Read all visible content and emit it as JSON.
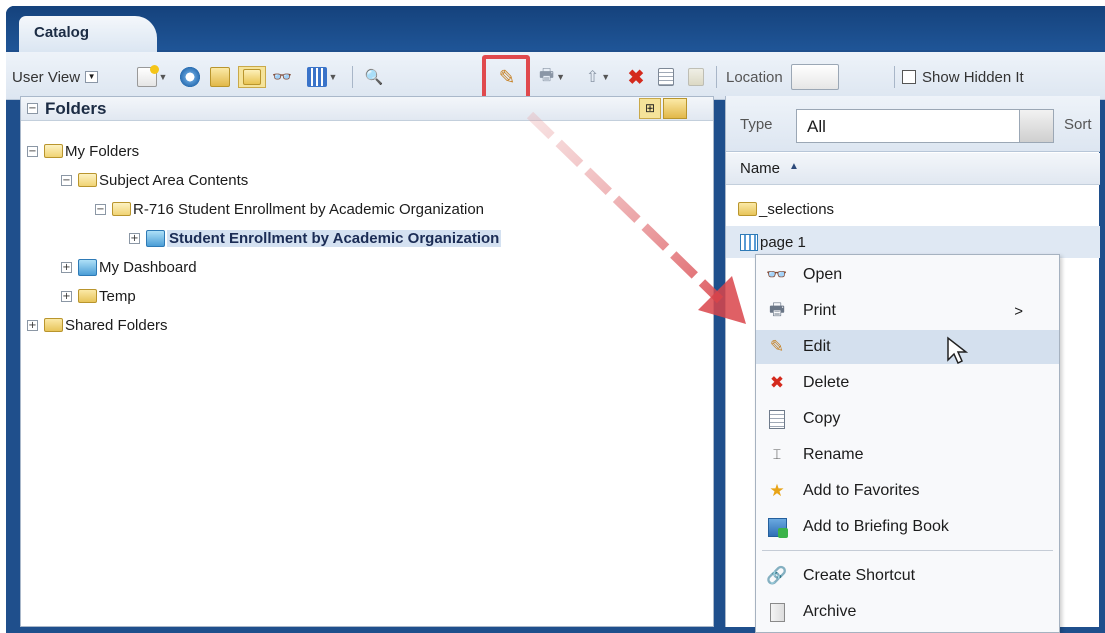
{
  "tab": {
    "label": "Catalog"
  },
  "toolbar": {
    "user_view_label": "User View",
    "location_label": "Location",
    "show_hidden_label": "Show Hidden It"
  },
  "folders_pane": {
    "title": "Folders",
    "tree": [
      {
        "label": "My Folders"
      },
      {
        "label": "Subject Area Contents"
      },
      {
        "label": "R-716 Student Enrollment by Academic Organization"
      },
      {
        "label": "Student Enrollment by Academic Organization"
      },
      {
        "label": "My Dashboard"
      },
      {
        "label": "Temp"
      },
      {
        "label": "Shared Folders"
      }
    ]
  },
  "right_pane": {
    "type_label": "Type",
    "type_value": "All",
    "sort_label": "Sort",
    "name_header": "Name",
    "items": [
      {
        "label": "_selections"
      },
      {
        "label": "page 1"
      }
    ]
  },
  "context_menu": {
    "items": [
      {
        "label": "Open",
        "icon": "binoculars-icon"
      },
      {
        "label": "Print",
        "icon": "printer-icon",
        "submenu": ">"
      },
      {
        "label": "Edit",
        "icon": "pencil-icon"
      },
      {
        "label": "Delete",
        "icon": "red-x-icon"
      },
      {
        "label": "Copy",
        "icon": "copy-icon"
      },
      {
        "label": "Rename",
        "icon": "rename-icon"
      },
      {
        "label": "Add to Favorites",
        "icon": "favorite-star-icon"
      },
      {
        "label": "Add to Briefing Book",
        "icon": "briefing-book-icon"
      },
      {
        "label": "Create Shortcut",
        "icon": "link-icon"
      },
      {
        "label": "Archive",
        "icon": "archive-icon"
      }
    ]
  },
  "colors": {
    "accent_highlight": "#e0494d",
    "frame_blue": "#1f4f8c",
    "selection": "#d4e1f1"
  }
}
